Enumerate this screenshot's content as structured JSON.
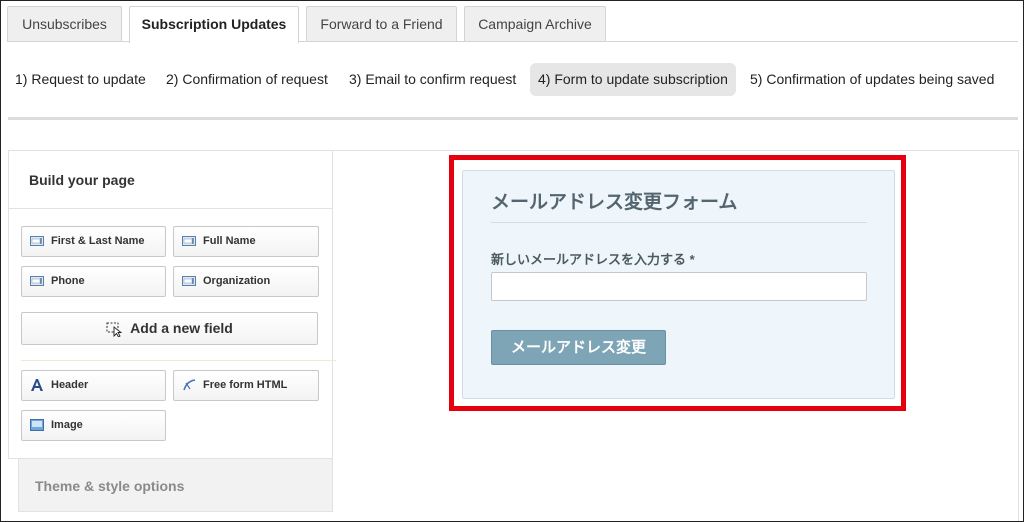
{
  "tabs": [
    {
      "label": "Unsubscribes",
      "active": false
    },
    {
      "label": "Subscription Updates",
      "active": true
    },
    {
      "label": "Forward to a Friend",
      "active": false
    },
    {
      "label": "Campaign Archive",
      "active": false
    }
  ],
  "steps": [
    {
      "label": "1) Request to update"
    },
    {
      "label": "2) Confirmation of request"
    },
    {
      "label": "3) Email to confirm request"
    },
    {
      "label": "4) Form to update subscription",
      "active": true
    },
    {
      "label": "5) Confirmation of updates being saved"
    }
  ],
  "build": {
    "title": "Build your page",
    "fields": [
      {
        "label": "First & Last Name",
        "icon": "field-icon"
      },
      {
        "label": "Full Name",
        "icon": "field-icon"
      },
      {
        "label": "Phone",
        "icon": "field-icon"
      },
      {
        "label": "Organization",
        "icon": "field-icon"
      }
    ],
    "add_field_label": "Add a new field",
    "blocks": [
      {
        "label": "Header",
        "icon": "header-icon"
      },
      {
        "label": "Free form HTML",
        "icon": "html-icon"
      },
      {
        "label": "Image",
        "icon": "image-icon"
      }
    ]
  },
  "theme": {
    "label": "Theme & style options"
  },
  "form": {
    "title": "メールアドレス変更フォーム",
    "field_label": "新しいメールアドレスを入力する *",
    "input_value": "",
    "submit_label": "メールアドレス変更"
  },
  "colors": {
    "highlight": "#e4000f",
    "button": "#7ea5b6",
    "form_bg": "#eef6fb"
  }
}
